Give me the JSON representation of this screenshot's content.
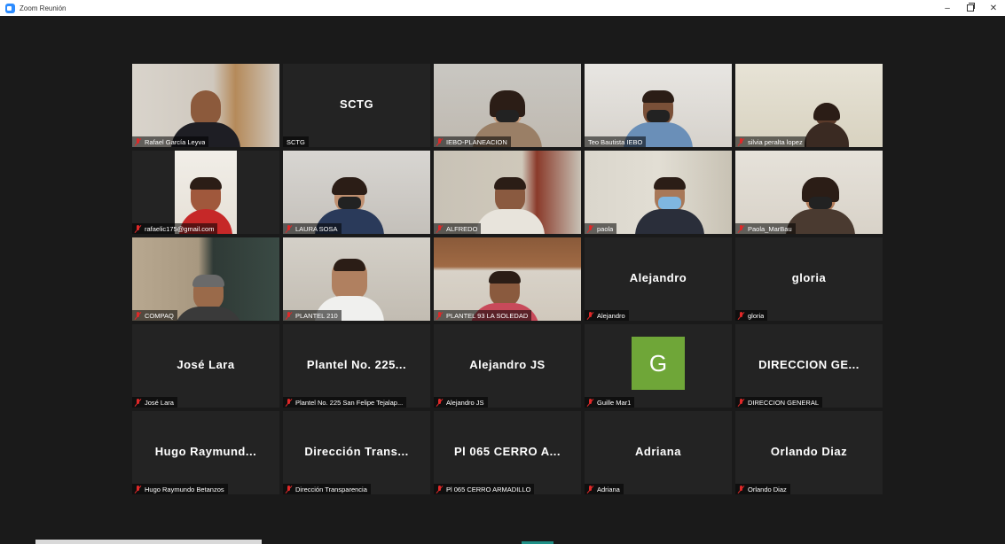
{
  "window": {
    "title": "Zoom Reunión",
    "controls": {
      "minimize": "–",
      "close": "✕"
    }
  },
  "colors": {
    "background": "#1a1a1a",
    "tile": "#232323",
    "active_speaker_border": "#a6d34a",
    "muted_icon": "#e02828",
    "avatar_g": "#6fa638"
  },
  "participants": [
    {
      "label": "Rafael García Leyva",
      "video": true
    },
    {
      "label": "SCTG",
      "display_name": "SCTG",
      "video": false
    },
    {
      "label": "IEBO-PLANEACION",
      "video": true
    },
    {
      "label": "Teo Bautista IEBO",
      "video": true,
      "active_speaker": true
    },
    {
      "label": "silvia peralta lopez",
      "video": true
    },
    {
      "label": "rafaelic175@gmail.com",
      "video": true
    },
    {
      "label": "LAURA SOSA",
      "video": true
    },
    {
      "label": "ALFREDO",
      "video": true
    },
    {
      "label": "paola",
      "video": true
    },
    {
      "label": "Paola_MarBau",
      "video": true
    },
    {
      "label": "COMPAQ",
      "video": true
    },
    {
      "label": "PLANTEL 210",
      "video": true
    },
    {
      "label": "PLANTEL 93 LA SOLEDAD",
      "video": true
    },
    {
      "label": "Alejandro",
      "display_name": "Alejandro",
      "video": false
    },
    {
      "label": "gloria",
      "display_name": "gloria",
      "video": false
    },
    {
      "label": "José Lara",
      "display_name": "José Lara",
      "video": false
    },
    {
      "label": "Plantel No. 225 San Felipe Tejalap...",
      "display_name": "Plantel No. 225...",
      "video": false
    },
    {
      "label": "Alejandro JS",
      "display_name": "Alejandro JS",
      "video": false
    },
    {
      "label": "Guille Mar1",
      "avatar_letter": "G",
      "video": false
    },
    {
      "label": "DIRECCION GENERAL",
      "display_name": "DIRECCION GE...",
      "video": false
    },
    {
      "label": "Hugo Raymundo Betanzos",
      "display_name": "Hugo Raymund...",
      "video": false
    },
    {
      "label": "Dirección Transparencia",
      "display_name": "Dirección Trans...",
      "video": false
    },
    {
      "label": "Pl 065 CERRO ARMADILLO",
      "display_name": "Pl 065 CERRO A...",
      "video": false
    },
    {
      "label": "Adriana",
      "display_name": "Adriana",
      "video": false
    },
    {
      "label": "Orlando Diaz",
      "display_name": "Orlando Diaz",
      "video": false
    }
  ]
}
